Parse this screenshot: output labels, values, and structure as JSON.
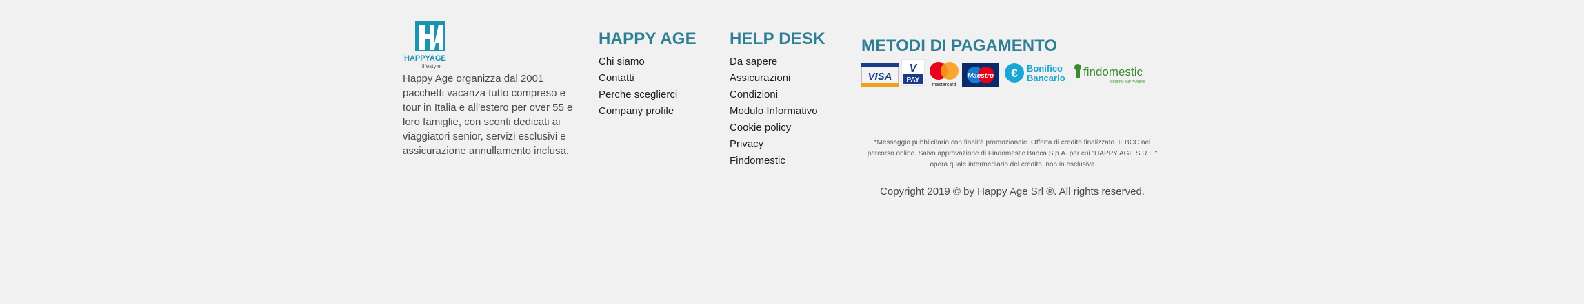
{
  "logo": {
    "brand": "HAPPYAGE",
    "tagline": "lifestyle",
    "colors": {
      "primary": "#1a95b0",
      "white": "#ffffff"
    }
  },
  "about": {
    "text": "Happy Age organizza dal 2001 pacchetti vacanza tutto compreso e tour in Italia e all'estero per over 55 e loro famiglie, con sconti dedicati ai viaggiatori senior, servizi esclusivi e assicurazione annullamento inclusa."
  },
  "happy_age": {
    "title": "HAPPY AGE",
    "links": [
      "Chi siamo",
      "Contatti",
      "Perche sceglierci",
      "Company profile"
    ]
  },
  "help_desk": {
    "title": "HELP DESK",
    "links": [
      "Da sapere",
      "Assicurazioni",
      "Condizioni",
      "Modulo Informativo",
      "Cookie policy",
      "Privacy",
      "Findomestic"
    ]
  },
  "payments": {
    "title": "METODI DI PAGAMENTO",
    "methods": {
      "visa": "VISA",
      "vpay_v": "V",
      "vpay": "PAY",
      "mastercard": "mastercard",
      "maestro": "Maestro",
      "bonifico_line1": "Bonifico",
      "bonifico_line2": "Bancario",
      "findomestic": "findomestic",
      "findomestic_sub": "GRUPPO BNP PARIBAS"
    }
  },
  "disclaimer": "*Messaggio pubblicitario con finalità promozionale. Offerta di credito finalizzato. IEBCC nel percorso online. Salvo approvazione di Findomestic Banca S.p.A. per cui \"HAPPY AGE S.R.L.\" opera quale intermediario del credito, non in esclusiva",
  "copyright": "Copyright 2019 © by Happy Age Srl ®. All rights reserved.",
  "colors": {
    "heading": "#2f7f94",
    "background": "#f1f1f1"
  }
}
